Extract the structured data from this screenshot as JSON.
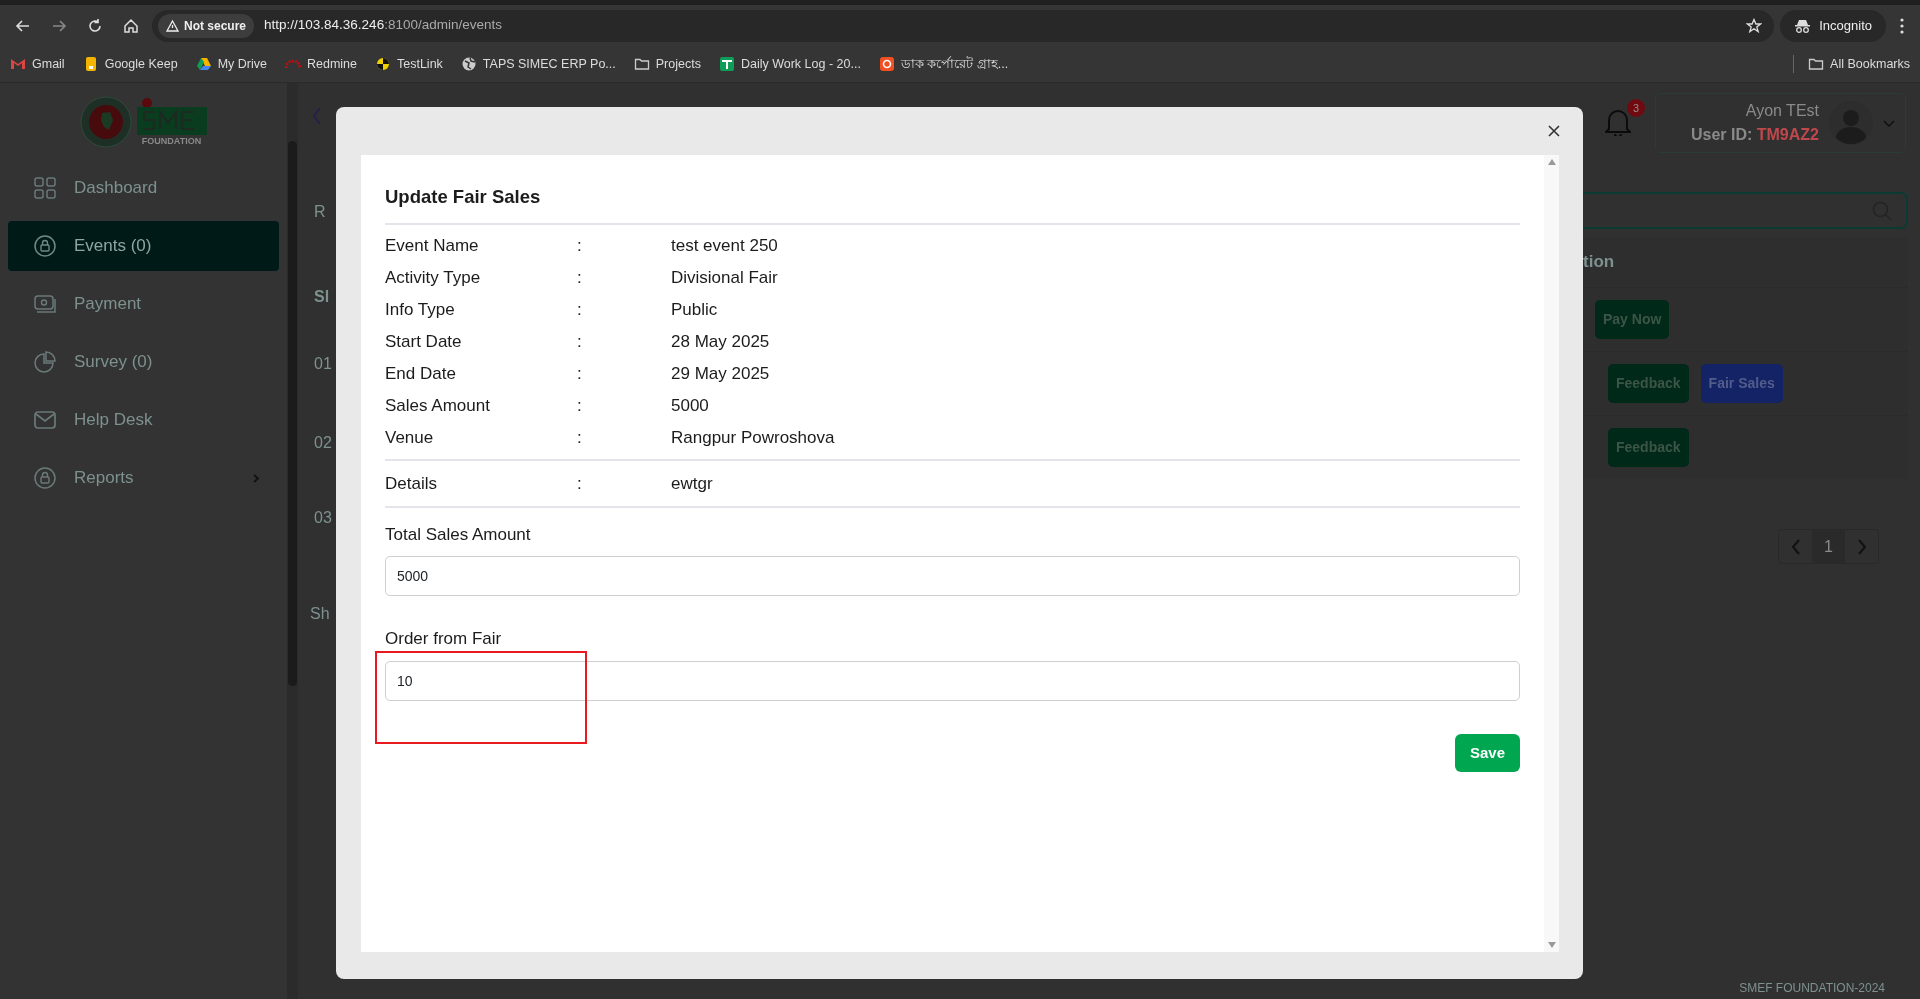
{
  "browser": {
    "security": "Not secure",
    "url_host": "http://103.84.36.246",
    "url_path": ":8100/admin/events",
    "profile": "Incognito",
    "all_bookmarks": "All Bookmarks",
    "bookmarks": [
      {
        "label": "Gmail"
      },
      {
        "label": "Google Keep"
      },
      {
        "label": "My Drive"
      },
      {
        "label": "Redmine"
      },
      {
        "label": "TestLink"
      },
      {
        "label": "TAPS SIMEC ERP Po..."
      },
      {
        "label": "Projects"
      },
      {
        "label": "Daily Work Log - 20..."
      },
      {
        "label": "ডাক কর্পোরেট গ্রাহ..."
      }
    ]
  },
  "sidebar": {
    "logo_text": "FOUNDATION",
    "items": [
      {
        "label": "Dashboard",
        "selected": false,
        "expandable": false
      },
      {
        "label": "Events (0)",
        "selected": true,
        "expandable": false
      },
      {
        "label": "Payment",
        "selected": false,
        "expandable": false
      },
      {
        "label": "Survey (0)",
        "selected": false,
        "expandable": false
      },
      {
        "label": "Help Desk",
        "selected": false,
        "expandable": false
      },
      {
        "label": "Reports",
        "selected": false,
        "expandable": true
      }
    ]
  },
  "header": {
    "notification_count": "3",
    "user_name": "Ayon TEst",
    "user_id_label": "User ID:",
    "user_id": "TM9AZ2"
  },
  "table": {
    "left_fragments": [
      "R",
      "Sl",
      "01",
      "02",
      "03",
      "Sh"
    ],
    "action_header": "tion",
    "rows": [
      {
        "actions": [
          {
            "label": "Pay Now",
            "kind": "success"
          }
        ]
      },
      {
        "actions": [
          {
            "label": "Feedback",
            "kind": "success"
          },
          {
            "label": "Fair Sales",
            "kind": "primary"
          }
        ]
      },
      {
        "actions": [
          {
            "label": "Feedback",
            "kind": "success"
          }
        ]
      }
    ],
    "page": "1"
  },
  "footer": "SMEF FOUNDATION-2024",
  "modal": {
    "title": "Update Fair Sales",
    "fields": [
      {
        "label": "Event Name",
        "value": "test event 250"
      },
      {
        "label": "Activity Type",
        "value": "Divisional Fair"
      },
      {
        "label": "Info Type",
        "value": "Public"
      },
      {
        "label": "Start Date",
        "value": "28 May 2025"
      },
      {
        "label": "End Date",
        "value": "29 May 2025"
      },
      {
        "label": "Sales Amount",
        "value": "5000"
      },
      {
        "label": "Venue",
        "value": "Rangpur Powroshova"
      }
    ],
    "details": {
      "label": "Details",
      "value": "ewtgr"
    },
    "separator": ":",
    "inputs": [
      {
        "label": "Total Sales Amount",
        "value": "5000",
        "highlighted": false
      },
      {
        "label": "Order from Fair",
        "value": "10",
        "highlighted": true
      }
    ],
    "save": "Save"
  }
}
